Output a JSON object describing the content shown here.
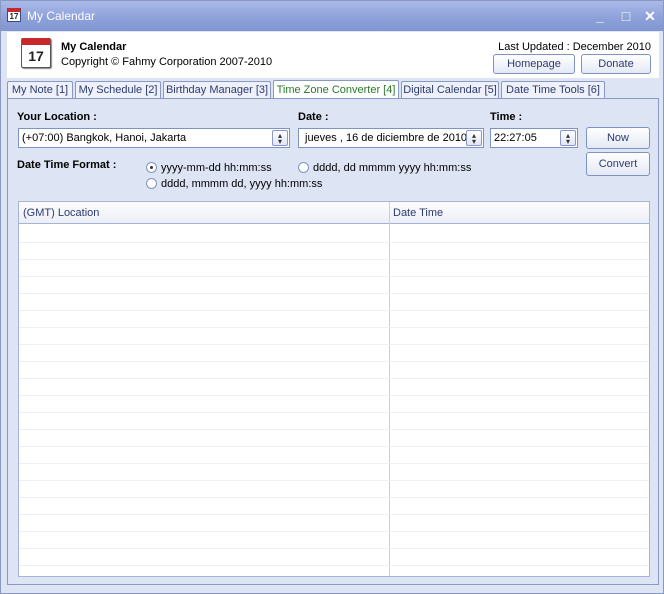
{
  "window": {
    "title": "My Calendar",
    "icon": "calendar-icon",
    "controls": [
      "minimize-icon",
      "maximize-icon",
      "close-icon"
    ]
  },
  "header": {
    "app_name": "My Calendar",
    "copyright": "Copyright © Fahmy Corporation 2007-2010",
    "last_updated": "Last Updated : December 2010",
    "icon_day": "17",
    "homepage_label": "Homepage",
    "donate_label": "Donate"
  },
  "tabs": [
    {
      "label": "My Note [1]"
    },
    {
      "label": "My Schedule [2]"
    },
    {
      "label": "Birthday Manager [3]"
    },
    {
      "label": "Time Zone Converter [4]",
      "active": true
    },
    {
      "label": "Digital Calendar [5]"
    },
    {
      "label": "Date Time Tools [6]"
    }
  ],
  "converter": {
    "location_label": "Your Location :",
    "location_value": "(+07:00) Bangkok, Hanoi, Jakarta",
    "date_label": "Date :",
    "date_value": "jueves   , 16 de  diciembre  de 2010",
    "time_label": "Time :",
    "time_value": "22:27:05",
    "now_label": "Now",
    "convert_label": "Convert",
    "format_label": "Date Time Format :",
    "formats": [
      {
        "label": "yyyy-mm-dd  hh:mm:ss",
        "selected": true
      },
      {
        "label": "dddd, dd mmmm yyyy  hh:mm:ss",
        "selected": false
      },
      {
        "label": "dddd, mmmm dd, yyyy  hh:mm:ss",
        "selected": false
      }
    ]
  },
  "grid": {
    "columns": [
      "(GMT) Location",
      "Date Time"
    ],
    "rows": []
  },
  "colors": {
    "titlebar": "#8ca0d8",
    "window_bg": "#dde4f4",
    "active_tab_text": "#2a7a2a",
    "link_text": "#2c3b6e"
  }
}
